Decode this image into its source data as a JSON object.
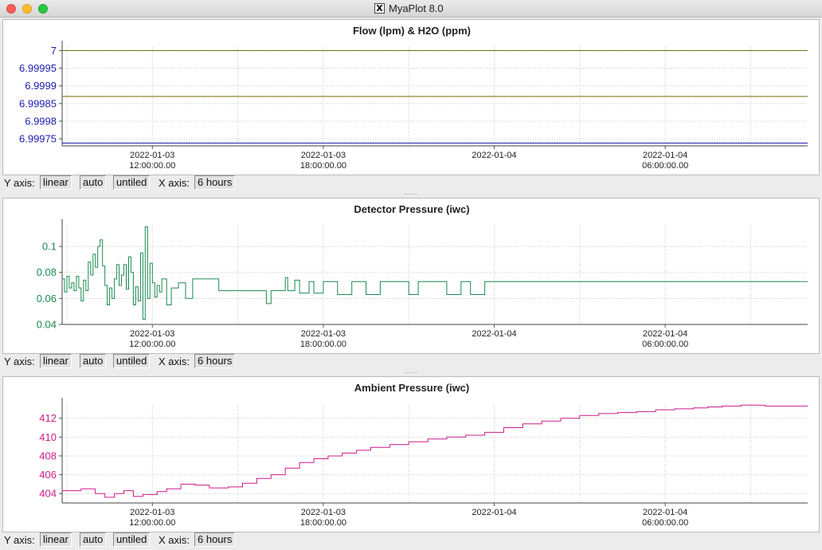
{
  "window": {
    "title": "MyaPlot 8.0",
    "icon": "x11-icon"
  },
  "controls": {
    "y_axis_label": "Y axis:",
    "scale": "linear",
    "range": "auto",
    "arrangement": "untiled",
    "x_axis_label": "X axis:",
    "span": "6 hours"
  },
  "colors": {
    "flow_series": "#6b6b00",
    "h2o_series": "#1c1cb0",
    "detector": "#1a8a50",
    "ambient": "#cc1c8c"
  },
  "x_ticks": [
    {
      "x": "2022-01-03 12:00:00",
      "line1": "2022-01-03",
      "line2": "12:00:00.00"
    },
    {
      "x": "2022-01-03 18:00:00",
      "line1": "2022-01-03",
      "line2": "18:00:00.00"
    },
    {
      "x": "2022-01-04 00:00:00",
      "line1": "2022-01-04",
      "line2": ""
    },
    {
      "x": "2022-01-04 06:00:00",
      "line1": "2022-01-04",
      "line2": "06:00:00.00"
    }
  ],
  "chart_data": [
    {
      "type": "line",
      "title": "Flow (lpm) & H2O (ppm)",
      "xrange": [
        "2022-01-03 08:50",
        "2022-01-04 11:00"
      ],
      "ylim": [
        6.99973,
        7.00001
      ],
      "y_ticks": [
        "7",
        "6.99995",
        "6.9999",
        "6.99985",
        "6.9998",
        "6.99975"
      ],
      "y_tick_values": [
        7,
        6.99995,
        6.9999,
        6.99985,
        6.9998,
        6.99975
      ],
      "y_tick_color": "#1c1cb0",
      "series": [
        {
          "color": "#6b6b00",
          "points": [
            [
              "2022-01-03 08:50",
              7.0
            ],
            [
              "2022-01-04 11:00",
              7.0
            ]
          ]
        },
        {
          "color": "#6b6b00",
          "points": [
            [
              "2022-01-03 08:50",
              6.99987
            ],
            [
              "2022-01-04 11:00",
              6.99987
            ]
          ]
        },
        {
          "color": "#1c1cb0",
          "points": [
            [
              "2022-01-03 08:50",
              6.999738
            ],
            [
              "2022-01-04 11:00",
              6.999738
            ]
          ]
        }
      ]
    },
    {
      "type": "line",
      "title": "Detector Pressure (iwc)",
      "xrange": [
        "2022-01-03 08:50",
        "2022-01-04 11:00"
      ],
      "ylim": [
        0.04,
        0.116
      ],
      "y_ticks": [
        "0.1",
        "0.08",
        "0.06",
        "0.04"
      ],
      "y_tick_values": [
        0.1,
        0.08,
        0.06,
        0.04
      ],
      "y_tick_color": "#1a8a50",
      "series": [
        {
          "color": "#1a8a50",
          "step": true,
          "points": [
            [
              "2022-01-03 08:50",
              0.075
            ],
            [
              "2022-01-03 08:55",
              0.065
            ],
            [
              "2022-01-03 09:00",
              0.077
            ],
            [
              "2022-01-03 09:05",
              0.068
            ],
            [
              "2022-01-03 09:10",
              0.072
            ],
            [
              "2022-01-03 09:15",
              0.066
            ],
            [
              "2022-01-03 09:20",
              0.077
            ],
            [
              "2022-01-03 09:25",
              0.068
            ],
            [
              "2022-01-03 09:30",
              0.058
            ],
            [
              "2022-01-03 09:35",
              0.074
            ],
            [
              "2022-01-03 09:40",
              0.066
            ],
            [
              "2022-01-03 09:45",
              0.088
            ],
            [
              "2022-01-03 09:50",
              0.078
            ],
            [
              "2022-01-03 09:55",
              0.094
            ],
            [
              "2022-01-03 10:00",
              0.084
            ],
            [
              "2022-01-03 10:05",
              0.1
            ],
            [
              "2022-01-03 10:10",
              0.105
            ],
            [
              "2022-01-03 10:15",
              0.085
            ],
            [
              "2022-01-03 10:20",
              0.07
            ],
            [
              "2022-01-03 10:25",
              0.055
            ],
            [
              "2022-01-03 10:30",
              0.068
            ],
            [
              "2022-01-03 10:35",
              0.06
            ],
            [
              "2022-01-03 10:40",
              0.075
            ],
            [
              "2022-01-03 10:45",
              0.086
            ],
            [
              "2022-01-03 10:50",
              0.07
            ],
            [
              "2022-01-03 10:55",
              0.078
            ],
            [
              "2022-01-03 11:00",
              0.086
            ],
            [
              "2022-01-03 11:05",
              0.067
            ],
            [
              "2022-01-03 11:10",
              0.092
            ],
            [
              "2022-01-03 11:15",
              0.08
            ],
            [
              "2022-01-03 11:20",
              0.055
            ],
            [
              "2022-01-03 11:25",
              0.069
            ],
            [
              "2022-01-03 11:30",
              0.058
            ],
            [
              "2022-01-03 11:35",
              0.095
            ],
            [
              "2022-01-03 11:40",
              0.044
            ],
            [
              "2022-01-03 11:45",
              0.115
            ],
            [
              "2022-01-03 11:50",
              0.06
            ],
            [
              "2022-01-03 11:55",
              0.087
            ],
            [
              "2022-01-03 12:00",
              0.072
            ],
            [
              "2022-01-03 12:05",
              0.061
            ],
            [
              "2022-01-03 12:10",
              0.07
            ],
            [
              "2022-01-03 12:15",
              0.065
            ],
            [
              "2022-01-03 12:20",
              0.075
            ],
            [
              "2022-01-03 12:30",
              0.055
            ],
            [
              "2022-01-03 12:40",
              0.068
            ],
            [
              "2022-01-03 12:55",
              0.072
            ],
            [
              "2022-01-03 13:10",
              0.06
            ],
            [
              "2022-01-03 13:25",
              0.075
            ],
            [
              "2022-01-03 14:20",
              0.066
            ],
            [
              "2022-01-03 16:00",
              0.056
            ],
            [
              "2022-01-03 16:10",
              0.066
            ],
            [
              "2022-01-03 16:40",
              0.076
            ],
            [
              "2022-01-03 16:45",
              0.066
            ],
            [
              "2022-01-03 17:00",
              0.074
            ],
            [
              "2022-01-03 17:10",
              0.064
            ],
            [
              "2022-01-03 17:30",
              0.073
            ],
            [
              "2022-01-03 17:40",
              0.064
            ],
            [
              "2022-01-03 18:00",
              0.073
            ],
            [
              "2022-01-03 18:30",
              0.063
            ],
            [
              "2022-01-03 19:00",
              0.073
            ],
            [
              "2022-01-03 19:30",
              0.063
            ],
            [
              "2022-01-03 20:00",
              0.073
            ],
            [
              "2022-01-03 21:00",
              0.063
            ],
            [
              "2022-01-03 21:20",
              0.073
            ],
            [
              "2022-01-03 22:20",
              0.063
            ],
            [
              "2022-01-03 22:50",
              0.073
            ],
            [
              "2022-01-03 23:10",
              0.063
            ],
            [
              "2022-01-03 23:40",
              0.073
            ],
            [
              "2022-01-04 11:00",
              0.073
            ]
          ]
        }
      ]
    },
    {
      "type": "line",
      "title": "Ambient Pressure (iwc)",
      "xrange": [
        "2022-01-03 08:50",
        "2022-01-04 11:00"
      ],
      "ylim": [
        403,
        413.5
      ],
      "y_ticks": [
        "412",
        "410",
        "408",
        "406",
        "404"
      ],
      "y_tick_values": [
        412,
        410,
        408,
        406,
        404
      ],
      "y_tick_color": "#cc1c8c",
      "series": [
        {
          "color": "#cc1c8c",
          "step": true,
          "points": [
            [
              "2022-01-03 08:50",
              404.3
            ],
            [
              "2022-01-03 09:30",
              404.5
            ],
            [
              "2022-01-03 10:00",
              404.0
            ],
            [
              "2022-01-03 10:20",
              403.6
            ],
            [
              "2022-01-03 10:40",
              404.0
            ],
            [
              "2022-01-03 11:00",
              404.3
            ],
            [
              "2022-01-03 11:20",
              403.7
            ],
            [
              "2022-01-03 11:40",
              403.9
            ],
            [
              "2022-01-03 12:10",
              404.2
            ],
            [
              "2022-01-03 12:30",
              404.5
            ],
            [
              "2022-01-03 13:00",
              405.0
            ],
            [
              "2022-01-03 13:30",
              404.9
            ],
            [
              "2022-01-03 14:00",
              404.6
            ],
            [
              "2022-01-03 14:40",
              404.7
            ],
            [
              "2022-01-03 15:10",
              405.1
            ],
            [
              "2022-01-03 15:40",
              405.6
            ],
            [
              "2022-01-03 16:10",
              406.0
            ],
            [
              "2022-01-03 16:40",
              406.7
            ],
            [
              "2022-01-03 17:10",
              407.3
            ],
            [
              "2022-01-03 17:40",
              407.7
            ],
            [
              "2022-01-03 18:10",
              408.0
            ],
            [
              "2022-01-03 18:40",
              408.3
            ],
            [
              "2022-01-03 19:10",
              408.6
            ],
            [
              "2022-01-03 19:40",
              408.9
            ],
            [
              "2022-01-03 20:20",
              409.2
            ],
            [
              "2022-01-03 21:00",
              409.5
            ],
            [
              "2022-01-03 21:40",
              409.8
            ],
            [
              "2022-01-03 22:20",
              410.0
            ],
            [
              "2022-01-03 23:00",
              410.2
            ],
            [
              "2022-01-03 23:40",
              410.5
            ],
            [
              "2022-01-04 00:20",
              411.0
            ],
            [
              "2022-01-04 01:00",
              411.4
            ],
            [
              "2022-01-04 01:40",
              411.7
            ],
            [
              "2022-01-04 02:20",
              412.0
            ],
            [
              "2022-01-04 03:00",
              412.3
            ],
            [
              "2022-01-04 03:40",
              412.5
            ],
            [
              "2022-01-04 04:20",
              412.6
            ],
            [
              "2022-01-04 05:00",
              412.7
            ],
            [
              "2022-01-04 05:40",
              412.9
            ],
            [
              "2022-01-04 06:20",
              413.0
            ],
            [
              "2022-01-04 07:00",
              413.1
            ],
            [
              "2022-01-04 07:30",
              413.2
            ],
            [
              "2022-01-04 08:00",
              413.3
            ],
            [
              "2022-01-04 08:40",
              413.4
            ],
            [
              "2022-01-04 09:30",
              413.3
            ],
            [
              "2022-01-04 11:00",
              413.3
            ]
          ]
        }
      ]
    }
  ]
}
